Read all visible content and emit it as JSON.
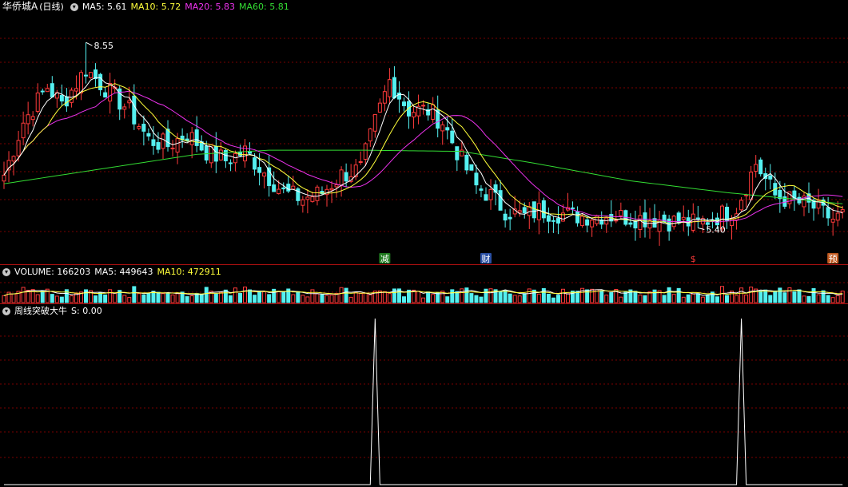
{
  "price_pane": {
    "title": "华侨城A",
    "period": "(日线)",
    "ma5_label": "MA5:",
    "ma5_value": "5.61",
    "ma10_label": "MA10:",
    "ma10_value": "5.72",
    "ma20_label": "MA20:",
    "ma20_value": "5.83",
    "ma60_label": "MA60:",
    "ma60_value": "5.81",
    "high_label": "8.55",
    "low_label": "5.40",
    "markers": [
      {
        "text": "减",
        "index": 79,
        "bg": "#1f7a1f"
      },
      {
        "text": "财",
        "index": 100,
        "bg": "#2a4fa3"
      },
      {
        "text": "$",
        "index": 143,
        "bg": "#000000",
        "color": "#ff3b3b"
      },
      {
        "text": "预",
        "index": 172,
        "bg": "#c0581e"
      }
    ],
    "colors": {
      "up": "#ff3b3b",
      "down": "#54f0f0",
      "ma5": "#ffffff",
      "ma10": "#ffff3a",
      "ma20": "#ee33ee",
      "ma60": "#33dd33",
      "grid": "#7a0000"
    }
  },
  "volume_pane": {
    "label": "VOLUME:",
    "value": "166203",
    "ma5_label": "MA5:",
    "ma5_value": "449643",
    "ma10_label": "MA10:",
    "ma10_value": "472911"
  },
  "indicator_pane": {
    "name": "周线突破大牛",
    "s_label": "S:",
    "s_value": "0.00",
    "signals": [
      77,
      153
    ]
  },
  "chart_data": [
    {
      "type": "candlestick",
      "title": "华侨城A (日线)",
      "ylim": [
        5.0,
        9.0
      ],
      "n": 175,
      "high_point": {
        "index": 17,
        "value": 8.55
      },
      "low_point": {
        "index": 144,
        "value": 5.4
      },
      "anchors": [
        [
          0,
          6.3
        ],
        [
          4,
          7.2
        ],
        [
          9,
          7.8
        ],
        [
          12,
          7.5
        ],
        [
          17,
          8.1
        ],
        [
          22,
          7.7
        ],
        [
          26,
          7.4
        ],
        [
          30,
          6.9
        ],
        [
          34,
          6.8
        ],
        [
          38,
          7.0
        ],
        [
          42,
          6.7
        ],
        [
          46,
          6.55
        ],
        [
          50,
          6.7
        ],
        [
          54,
          6.35
        ],
        [
          58,
          6.0
        ],
        [
          62,
          5.9
        ],
        [
          66,
          6.0
        ],
        [
          70,
          6.3
        ],
        [
          74,
          6.4
        ],
        [
          77,
          7.2
        ],
        [
          80,
          7.9
        ],
        [
          84,
          7.4
        ],
        [
          88,
          7.4
        ],
        [
          91,
          7.2
        ],
        [
          94,
          6.7
        ],
        [
          98,
          6.1
        ],
        [
          101,
          5.95
        ],
        [
          104,
          5.7
        ],
        [
          108,
          5.6
        ],
        [
          111,
          5.7
        ],
        [
          115,
          5.65
        ],
        [
          120,
          5.6
        ],
        [
          125,
          5.62
        ],
        [
          130,
          5.58
        ],
        [
          135,
          5.55
        ],
        [
          140,
          5.5
        ],
        [
          144,
          5.48
        ],
        [
          148,
          5.6
        ],
        [
          152,
          5.75
        ],
        [
          156,
          6.5
        ],
        [
          160,
          5.95
        ],
        [
          164,
          5.85
        ],
        [
          168,
          5.75
        ],
        [
          172,
          5.55
        ],
        [
          174,
          5.61
        ]
      ],
      "ma60_anchors": [
        [
          0,
          6.15
        ],
        [
          20,
          6.4
        ],
        [
          40,
          6.65
        ],
        [
          55,
          6.72
        ],
        [
          75,
          6.72
        ],
        [
          95,
          6.7
        ],
        [
          110,
          6.5
        ],
        [
          130,
          6.2
        ],
        [
          150,
          6.0
        ],
        [
          165,
          5.88
        ],
        [
          174,
          5.81
        ]
      ],
      "last": {
        "ma5": 5.61,
        "ma10": 5.72,
        "ma20": 5.83,
        "ma60": 5.81
      }
    },
    {
      "type": "bar",
      "title": "VOLUME",
      "last": {
        "volume": 166203,
        "ma5": 449643,
        "ma10": 472911
      },
      "ylim": [
        0,
        1600000
      ]
    },
    {
      "type": "line",
      "title": "周线突破大牛",
      "series": [
        {
          "name": "S",
          "signal_indices": [
            77,
            153
          ],
          "last": 0.0
        }
      ],
      "ylim": [
        0,
        1
      ]
    }
  ]
}
